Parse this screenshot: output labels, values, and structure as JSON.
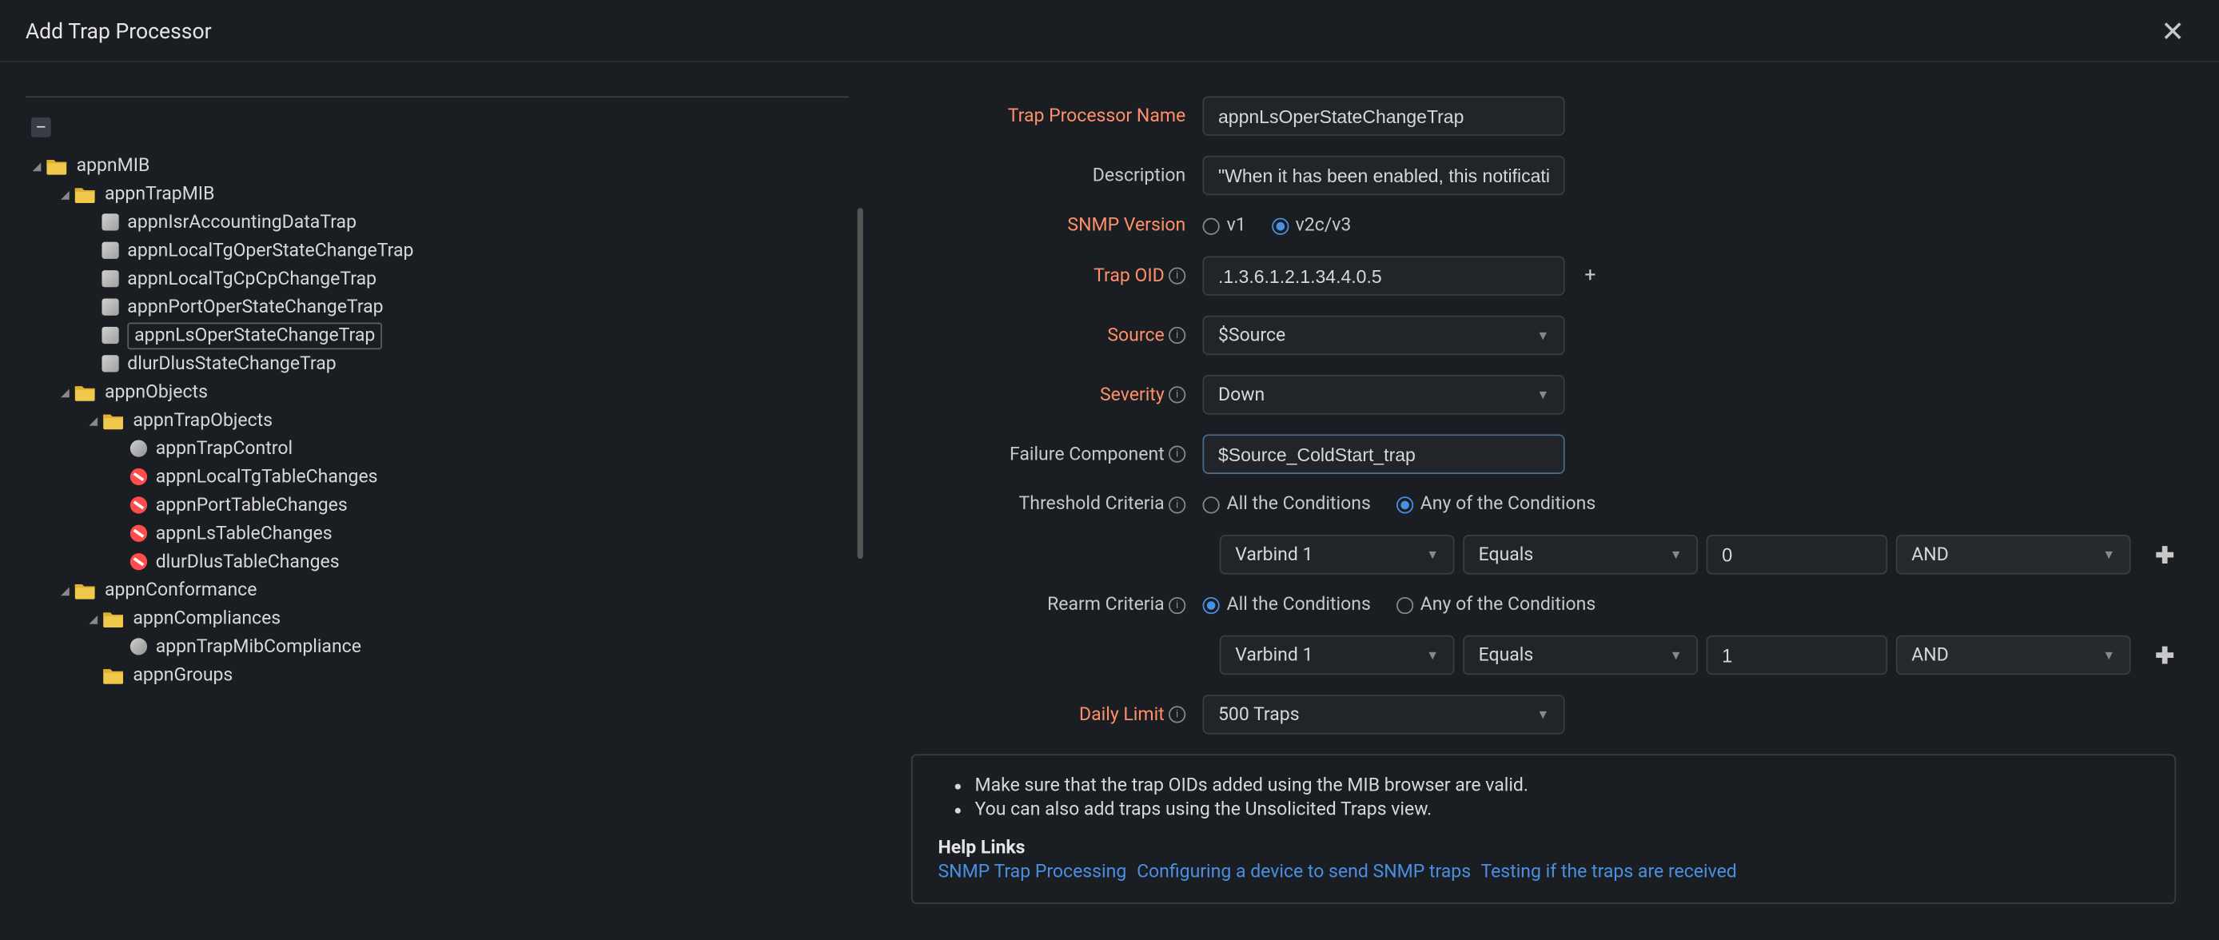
{
  "modal": {
    "title": "Add Trap Processor"
  },
  "tree": {
    "collapse": "–",
    "root": "appnMIB",
    "trapMib": "appnTrapMIB",
    "leaves1": [
      "appnIsrAccountingDataTrap",
      "appnLocalTgOperStateChangeTrap",
      "appnLocalTgCpCpChangeTrap",
      "appnPortOperStateChangeTrap",
      "appnLsOperStateChangeTrap",
      "dlurDlusStateChangeTrap"
    ],
    "objects": "appnObjects",
    "trapObjects": "appnTrapObjects",
    "control": "appnTrapControl",
    "changes": [
      "appnLocalTgTableChanges",
      "appnPortTableChanges",
      "appnLsTableChanges",
      "dlurDlusTableChanges"
    ],
    "conformance": "appnConformance",
    "compliances": "appnCompliances",
    "mibCompliance": "appnTrapMibCompliance",
    "groups": "appnGroups"
  },
  "labels": {
    "name": "Trap Processor Name",
    "desc": "Description",
    "snmp": "SNMP Version",
    "oid": "Trap OID",
    "source": "Source",
    "severity": "Severity",
    "failure": "Failure Component",
    "threshold": "Threshold Criteria",
    "rearm": "Rearm Criteria",
    "daily": "Daily Limit"
  },
  "values": {
    "name": "appnLsOperStateChangeTrap",
    "desc": "\"When it has been enabled, this notification mak",
    "v1": "v1",
    "v2": "v2c/v3",
    "oid": ".1.3.6.1.2.1.34.4.0.5",
    "source": "$Source",
    "severity": "Down",
    "failure": "$Source_ColdStart_trap",
    "allCond": "All the Conditions",
    "anyCond": "Any of the Conditions",
    "varbind": "Varbind 1",
    "op": "Equals",
    "tval": "0",
    "rval": "1",
    "logic": "AND",
    "daily": "500 Traps"
  },
  "help": {
    "note1": "Make sure that the trap OIDs added using the MIB browser are valid.",
    "note2": "You can also add traps using the Unsolicited Traps view.",
    "title": "Help Links",
    "link1": "SNMP Trap Processing",
    "link2": "Configuring a device to send SNMP traps",
    "link3": "Testing if the traps are received"
  }
}
